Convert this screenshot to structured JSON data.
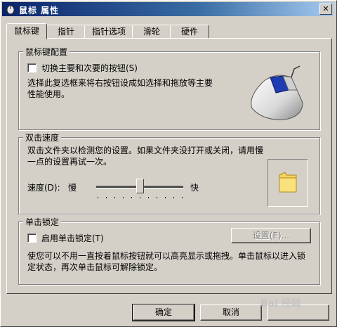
{
  "window": {
    "title": "鼠标 属性",
    "close_label": "✕"
  },
  "tabs": [
    {
      "label": "鼠标键",
      "active": true
    },
    {
      "label": "指针",
      "active": false
    },
    {
      "label": "指针选项",
      "active": false
    },
    {
      "label": "滑轮",
      "active": false
    },
    {
      "label": "硬件",
      "active": false
    }
  ],
  "button_config": {
    "group_label": "鼠标键配置",
    "swap_checkbox_label": "切换主要和次要的按钮(S)",
    "swap_checked": false,
    "description": "选择此复选框来将右按钮设成如选择和拖放等主要性能使用。"
  },
  "double_click": {
    "group_label": "双击速度",
    "description": "双击文件夹以检测您的设置。如果文件夹没打开或关闭，请用慢一点的设置再试一次。",
    "speed_label": "速度(D):",
    "slow_label": "慢",
    "fast_label": "快",
    "speed_value": 0.5
  },
  "click_lock": {
    "group_label": "单击锁定",
    "checkbox_label": "启用单击锁定(T)",
    "checked": false,
    "settings_button": "设置(E)...",
    "description": "使您可以不用一直按着鼠标按钮就可以高亮显示或拖拽。单击鼠标以进入锁定状态，再次单击鼠标可解除锁定。"
  },
  "footer": {
    "ok_label": "确定",
    "cancel_label": "取消"
  },
  "watermark": {
    "text": "Bai 经验"
  }
}
